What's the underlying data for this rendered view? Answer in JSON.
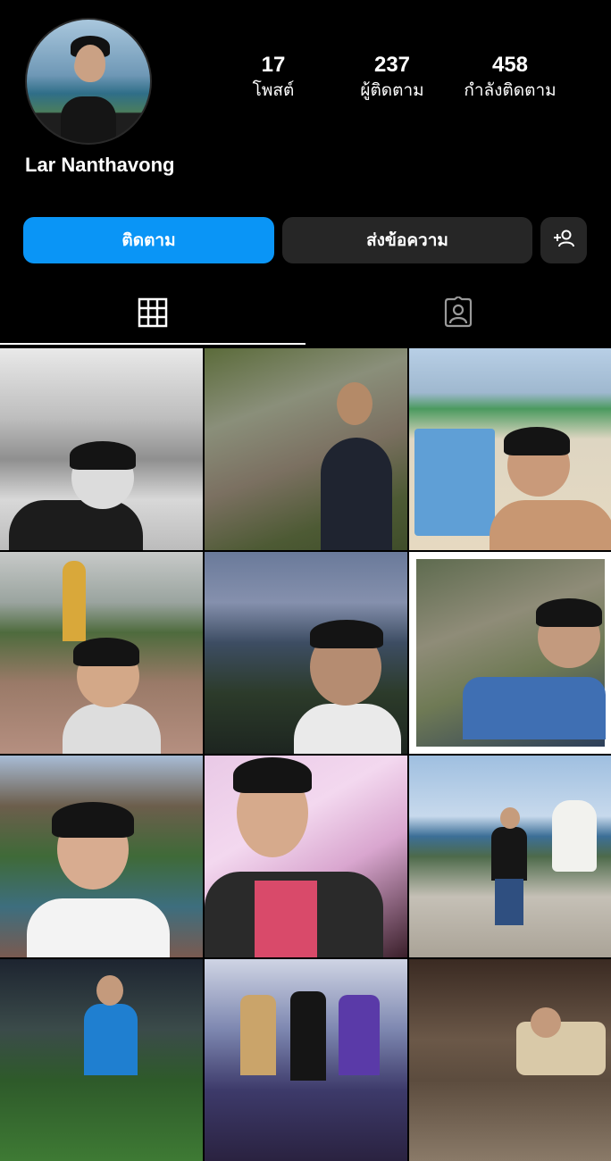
{
  "profile": {
    "username": "Lar Nanthavong",
    "avatar_icon": "profile-avatar"
  },
  "stats": [
    {
      "value": "17",
      "label": "โพสต์"
    },
    {
      "value": "237",
      "label": "ผู้ติดตาม"
    },
    {
      "value": "458",
      "label": "กำลังติดตาม"
    }
  ],
  "actions": {
    "follow_label": "ติดตาม",
    "message_label": "ส่งข้อความ",
    "add_friend_icon": "add-user-icon"
  },
  "tabs": [
    {
      "icon": "grid-icon",
      "active": true
    },
    {
      "icon": "tagged-person-icon",
      "active": false
    }
  ],
  "colors": {
    "accent": "#0a95f6",
    "secondary_button": "#262626",
    "background": "#000000"
  },
  "posts": [
    {
      "name": "post-street-selfie-bw"
    },
    {
      "name": "post-waterfall"
    },
    {
      "name": "post-beach-chairs"
    },
    {
      "name": "post-golden-buddha"
    },
    {
      "name": "post-river-view"
    },
    {
      "name": "post-riverbank"
    },
    {
      "name": "post-garden-selfie"
    },
    {
      "name": "post-pink-event"
    },
    {
      "name": "post-coastal-lion-statue"
    },
    {
      "name": "post-football-field"
    },
    {
      "name": "post-stage-performance"
    },
    {
      "name": "post-field-bag"
    }
  ]
}
